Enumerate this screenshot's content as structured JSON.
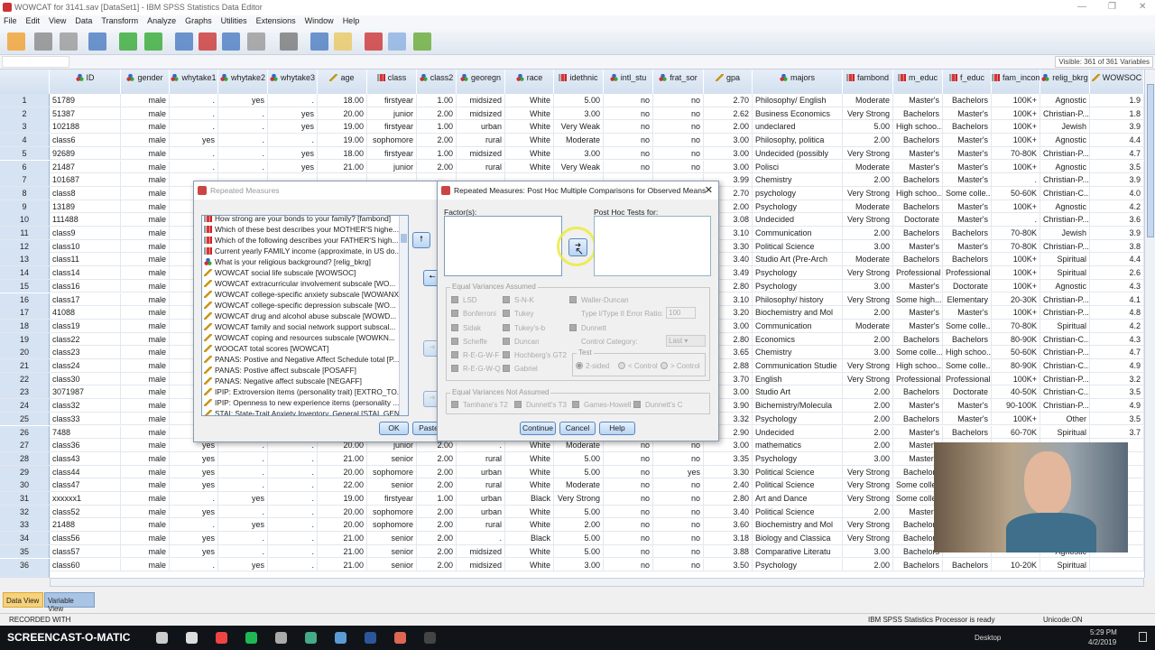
{
  "window": {
    "title": "WOWCAT for 3141.sav [DataSet1] - IBM SPSS Statistics Data Editor"
  },
  "menu": [
    "File",
    "Edit",
    "View",
    "Data",
    "Transform",
    "Analyze",
    "Graphs",
    "Utilities",
    "Extensions",
    "Window",
    "Help"
  ],
  "visible_vars": "Visible: 361 of 361 Variables",
  "columns": [
    {
      "name": "ID",
      "type": "nom"
    },
    {
      "name": "gender",
      "type": "nom"
    },
    {
      "name": "whytake1",
      "type": "nom"
    },
    {
      "name": "whytake2",
      "type": "nom"
    },
    {
      "name": "whytake3",
      "type": "nom"
    },
    {
      "name": "age",
      "type": "sca"
    },
    {
      "name": "class",
      "type": "ord"
    },
    {
      "name": "class2",
      "type": "nom"
    },
    {
      "name": "georegn",
      "type": "nom"
    },
    {
      "name": "race",
      "type": "nom"
    },
    {
      "name": "idethnic",
      "type": "ord"
    },
    {
      "name": "intl_stu",
      "type": "nom"
    },
    {
      "name": "frat_sor",
      "type": "nom"
    },
    {
      "name": "gpa",
      "type": "sca"
    },
    {
      "name": "majors",
      "type": "nom"
    },
    {
      "name": "fambond",
      "type": "ord"
    },
    {
      "name": "m_educ",
      "type": "ord"
    },
    {
      "name": "f_educ",
      "type": "ord"
    },
    {
      "name": "fam_income",
      "type": "ord"
    },
    {
      "name": "relig_bkrg",
      "type": "nom"
    },
    {
      "name": "WOWSOC",
      "type": "sca"
    }
  ],
  "rows": [
    [
      "51789",
      "male",
      ".",
      "yes",
      ".",
      "18.00",
      "firstyear",
      "1.00",
      "midsized",
      "White",
      "5.00",
      "no",
      "no",
      "2.70",
      "Philosophy/ English",
      "Moderate",
      "Master's",
      "Bachelors",
      "100K+",
      "Agnostic",
      "1.9"
    ],
    [
      "51387",
      "male",
      ".",
      ".",
      "yes",
      "20.00",
      "junior",
      "2.00",
      "midsized",
      "White",
      "3.00",
      "no",
      "no",
      "2.62",
      "Business Economics",
      "Very Strong",
      "Bachelors",
      "Master's",
      "100K+",
      "Christian-P...",
      "1.8"
    ],
    [
      "102188",
      "male",
      ".",
      ".",
      "yes",
      "19.00",
      "firstyear",
      "1.00",
      "urban",
      "White",
      "Very Weak",
      "no",
      "no",
      "2.00",
      "undeclared",
      "5.00",
      "High schoo...",
      "Bachelors",
      "100K+",
      "Jewish",
      "3.9"
    ],
    [
      "class6",
      "male",
      "yes",
      ".",
      ".",
      "19.00",
      "sophomore",
      "2.00",
      "rural",
      "White",
      "Moderate",
      "no",
      "no",
      "3.00",
      "Philosophy, politica",
      "2.00",
      "Bachelors",
      "Master's",
      "100K+",
      "Agnostic",
      "4.4"
    ],
    [
      "92689",
      "male",
      ".",
      ".",
      "yes",
      "18.00",
      "firstyear",
      "1.00",
      "midsized",
      "White",
      "3.00",
      "no",
      "no",
      "3.00",
      "Undecided (possibly",
      "Very Strong",
      "Master's",
      "Master's",
      "70-80K",
      "Christian-P...",
      "4.7"
    ],
    [
      "21487",
      "male",
      ".",
      ".",
      "yes",
      "21.00",
      "junior",
      "2.00",
      "rural",
      "White",
      "Very Weak",
      "no",
      "no",
      "3.00",
      "Polisci",
      "Moderate",
      "Master's",
      "Master's",
      "100K+",
      "Agnostic",
      "3.5"
    ],
    [
      "101687",
      "male",
      null,
      null,
      null,
      null,
      null,
      null,
      null,
      null,
      null,
      null,
      null,
      "3.99",
      "Chemistry",
      "2.00",
      "Bachelors",
      "Master's",
      ".",
      "Christian-P...",
      "3.9"
    ],
    [
      "class8",
      "male",
      null,
      null,
      null,
      null,
      null,
      null,
      null,
      null,
      null,
      null,
      null,
      "2.70",
      "psychology",
      "Very Strong",
      "High schoo...",
      "Some colle...",
      "50-60K",
      "Christian-C...",
      "4.0"
    ],
    [
      "13189",
      "male",
      null,
      null,
      null,
      null,
      null,
      null,
      null,
      null,
      null,
      null,
      null,
      "2.00",
      "Psychology",
      "Moderate",
      "Bachelors",
      "Master's",
      "100K+",
      "Agnostic",
      "4.2"
    ],
    [
      "111488",
      "male",
      null,
      null,
      null,
      null,
      null,
      null,
      null,
      null,
      null,
      null,
      null,
      "3.08",
      "Undecided",
      "Very Strong",
      "Doctorate",
      "Master's",
      ".",
      "Christian-P...",
      "3.6"
    ],
    [
      "class9",
      "male",
      null,
      null,
      null,
      null,
      null,
      null,
      null,
      null,
      null,
      null,
      null,
      "3.10",
      "Communication",
      "2.00",
      "Bachelors",
      "Bachelors",
      "70-80K",
      "Jewish",
      "3.9"
    ],
    [
      "class10",
      "male",
      null,
      null,
      null,
      null,
      null,
      null,
      null,
      null,
      null,
      null,
      null,
      "3.30",
      "Political Science",
      "3.00",
      "Master's",
      "Master's",
      "70-80K",
      "Christian-P...",
      "3.8"
    ],
    [
      "class11",
      "male",
      null,
      null,
      null,
      null,
      null,
      null,
      null,
      null,
      null,
      null,
      null,
      "3.40",
      "Studio Art (Pre-Arch",
      "Moderate",
      "Bachelors",
      "Bachelors",
      "100K+",
      "Spiritual",
      "4.4"
    ],
    [
      "class14",
      "male",
      null,
      null,
      null,
      null,
      null,
      null,
      null,
      null,
      null,
      null,
      null,
      "3.49",
      "Psychology",
      "Very Strong",
      "Professional",
      "Professional",
      "100K+",
      "Spiritual",
      "2.6"
    ],
    [
      "class16",
      "male",
      null,
      null,
      null,
      null,
      null,
      null,
      null,
      null,
      null,
      null,
      null,
      "2.80",
      "Psychology",
      "3.00",
      "Master's",
      "Doctorate",
      "100K+",
      "Agnostic",
      "4.3"
    ],
    [
      "class17",
      "male",
      null,
      null,
      null,
      null,
      null,
      null,
      null,
      null,
      null,
      null,
      null,
      "3.10",
      "Philosophy/ history",
      "Very Strong",
      "Some high...",
      "Elementary",
      "20-30K",
      "Christian-P...",
      "4.1"
    ],
    [
      "41088",
      "male",
      null,
      null,
      null,
      null,
      null,
      null,
      null,
      null,
      null,
      null,
      null,
      "3.20",
      "Biochemistry and Mol",
      "2.00",
      "Master's",
      "Master's",
      "100K+",
      "Christian-P...",
      "4.8"
    ],
    [
      "class19",
      "male",
      null,
      null,
      null,
      null,
      null,
      null,
      null,
      null,
      null,
      null,
      null,
      "3.00",
      "Communication",
      "Moderate",
      "Master's",
      "Some colle...",
      "70-80K",
      "Spiritual",
      "4.2"
    ],
    [
      "class22",
      "male",
      null,
      null,
      null,
      null,
      null,
      null,
      null,
      null,
      null,
      null,
      null,
      "2.80",
      "Economics",
      "2.00",
      "Bachelors",
      "Bachelors",
      "80-90K",
      "Christian-C...",
      "4.3"
    ],
    [
      "class23",
      "male",
      null,
      null,
      null,
      null,
      null,
      null,
      null,
      null,
      null,
      null,
      null,
      "3.65",
      "Chemistry",
      "3.00",
      "Some colle...",
      "High schoo...",
      "50-60K",
      "Christian-P...",
      "4.7"
    ],
    [
      "class24",
      "male",
      null,
      null,
      null,
      null,
      null,
      null,
      null,
      null,
      null,
      null,
      null,
      "2.88",
      "Communication Studie",
      "Very Strong",
      "High schoo...",
      "Some colle...",
      "80-90K",
      "Christian-C...",
      "4.9"
    ],
    [
      "class30",
      "male",
      null,
      null,
      null,
      null,
      null,
      null,
      null,
      null,
      null,
      null,
      null,
      "3.70",
      "English",
      "Very Strong",
      "Professional",
      "Professional",
      "100K+",
      "Christian-P...",
      "3.2"
    ],
    [
      "3071987",
      "male",
      null,
      null,
      null,
      null,
      null,
      null,
      null,
      null,
      null,
      null,
      null,
      "3.00",
      "Studio Art",
      "2.00",
      "Bachelors",
      "Doctorate",
      "40-50K",
      "Christian-C...",
      "3.5"
    ],
    [
      "class32",
      "male",
      null,
      null,
      null,
      null,
      null,
      null,
      null,
      null,
      null,
      null,
      null,
      "3.90",
      "Bichemistry/Molecula",
      "2.00",
      "Master's",
      "Master's",
      "90-100K",
      "Christian-P...",
      "4.9"
    ],
    [
      "class33",
      "male",
      null,
      null,
      null,
      null,
      null,
      null,
      null,
      null,
      null,
      null,
      null,
      "3.32",
      "Psychology",
      "2.00",
      "Bachelors",
      "Master's",
      "100K+",
      "Other",
      "3.5"
    ],
    [
      "7488",
      "male",
      null,
      null,
      null,
      null,
      null,
      null,
      null,
      null,
      null,
      null,
      null,
      "2.90",
      "Undecided",
      "2.00",
      "Master's",
      "Bachelors",
      "60-70K",
      "Spiritual",
      "3.7"
    ],
    [
      "class36",
      "male",
      "yes",
      ".",
      ".",
      "20.00",
      "junior",
      "2.00",
      ".",
      "White",
      "Moderate",
      "no",
      "no",
      "3.00",
      "mathematics",
      "2.00",
      "Master's",
      null,
      null,
      null,
      null
    ],
    [
      "class43",
      "male",
      "yes",
      ".",
      ".",
      "21.00",
      "senior",
      "2.00",
      "rural",
      "White",
      "5.00",
      "no",
      "no",
      "3.35",
      "Psychology",
      "3.00",
      "Master's",
      null,
      null,
      null,
      null
    ],
    [
      "class44",
      "male",
      "yes",
      ".",
      ".",
      "20.00",
      "sophomore",
      "2.00",
      "urban",
      "White",
      "5.00",
      "no",
      "yes",
      "3.30",
      "Political Science",
      "Very Strong",
      "Bachelors",
      null,
      null,
      null,
      null
    ],
    [
      "class47",
      "male",
      "yes",
      ".",
      ".",
      "22.00",
      "senior",
      "2.00",
      "rural",
      "White",
      "Moderate",
      "no",
      "no",
      "2.40",
      "Political Science",
      "Very Strong",
      "Some colle...",
      null,
      null,
      null,
      null
    ],
    [
      "xxxxxx1",
      "male",
      ".",
      "yes",
      ".",
      "19.00",
      "firstyear",
      "1.00",
      "urban",
      "Black",
      "Very Strong",
      "no",
      "no",
      "2.80",
      "Art and Dance",
      "Very Strong",
      "Some colle...",
      null,
      null,
      null,
      null
    ],
    [
      "class52",
      "male",
      "yes",
      ".",
      ".",
      "20.00",
      "sophomore",
      "2.00",
      "urban",
      "White",
      "5.00",
      "no",
      "no",
      "3.40",
      "Political Science",
      "2.00",
      "Master's",
      null,
      null,
      null,
      null
    ],
    [
      "21488",
      "male",
      ".",
      "yes",
      ".",
      "20.00",
      "sophomore",
      "2.00",
      "rural",
      "White",
      "2.00",
      "no",
      "no",
      "3.60",
      "Biochemistry and Mol",
      "Very Strong",
      "Bachelors",
      null,
      null,
      null,
      null
    ],
    [
      "class56",
      "male",
      "yes",
      ".",
      ".",
      "21.00",
      "senior",
      "2.00",
      ".",
      "Black",
      "5.00",
      "no",
      "no",
      "3.18",
      "Biology and Classica",
      "Very Strong",
      "Bachelors",
      null,
      null,
      null,
      null
    ],
    [
      "class57",
      "male",
      "yes",
      ".",
      ".",
      "21.00",
      "senior",
      "2.00",
      "midsized",
      "White",
      "5.00",
      "no",
      "no",
      "3.88",
      "Comparative Literatu",
      "3.00",
      "Bachelors",
      null,
      null,
      "Agnostic",
      null
    ],
    [
      "class60",
      "male",
      ".",
      "yes",
      ".",
      "21.00",
      "senior",
      "2.00",
      "midsized",
      "White",
      "3.00",
      "no",
      "no",
      "3.50",
      "Psychology",
      "2.00",
      "Bachelors",
      "Bachelors",
      "10-20K",
      "Spiritual",
      null
    ]
  ],
  "tabs": {
    "data_view": "Data View",
    "variable_view": "Variable View"
  },
  "status": {
    "recorded": "RECORDED WITH",
    "processor": "IBM SPSS Statistics Processor is ready",
    "unicode": "Unicode:ON"
  },
  "taskbar": {
    "desktop": "Desktop",
    "time": "5:29 PM",
    "date": "4/2/2019",
    "screencast": "SCREENCAST-O-MATIC"
  },
  "rm_dialog": {
    "title": "Repeated Measures",
    "ok": "OK",
    "paste": "Paste",
    "variables": [
      {
        "label": "How strong are your bonds to your family? [fambond]",
        "type": "ord"
      },
      {
        "label": "Which of these best describes your MOTHER'S highe...",
        "type": "ord"
      },
      {
        "label": "Which of the following describes your FATHER'S high...",
        "type": "ord"
      },
      {
        "label": "Current yearly FAMILY income (approximate, in US do...",
        "type": "ord"
      },
      {
        "label": "What is your religious background? [relig_bkrg]",
        "type": "nom"
      },
      {
        "label": "WOWCAT social life subscale [WOWSOC]",
        "type": "sca"
      },
      {
        "label": "WOWCAT extracurricular involvement subscale [WO...",
        "type": "sca"
      },
      {
        "label": "WOWCAT college-specific anxiety subscale [WOWANX]",
        "type": "sca"
      },
      {
        "label": "WOWCAT college-specific depression subscale [WO...",
        "type": "sca"
      },
      {
        "label": "WOWCAT drug and alcohol abuse subscale [WOWD...",
        "type": "sca"
      },
      {
        "label": "WOWCAT family and social network support subscal...",
        "type": "sca"
      },
      {
        "label": "WOWCAT coping and resources subscale [WOWKN...",
        "type": "sca"
      },
      {
        "label": "WOOCAT total scores [WOWCAT]",
        "type": "sca"
      },
      {
        "label": "PANAS: Postive and Negative Affect Schedule total [P...",
        "type": "sca"
      },
      {
        "label": "PANAS: Postive affect subscale [POSAFF]",
        "type": "sca"
      },
      {
        "label": "PANAS: Negative affect subscale [NEGAFF]",
        "type": "sca"
      },
      {
        "label": "IPIP: Extroversion items (personality trait) [EXTRO_TO...",
        "type": "sca"
      },
      {
        "label": "IPIP: Openness to new experience items (personality ...",
        "type": "sca"
      },
      {
        "label": "STAI: State-Trait Anxiety Inventory, General [STAI_GENI",
        "type": "sca"
      }
    ]
  },
  "posthoc": {
    "title": "Repeated Measures: Post Hoc Multiple Comparisons for Observed Means",
    "factors_label": "Factor(s):",
    "tests_for_label": "Post Hoc Tests for:",
    "eva_label": "Equal Variances Assumed",
    "eva": [
      "LSD",
      "Bonferroni",
      "Sidak",
      "Scheffe",
      "R-E-G-W-F",
      "R-E-G-W-Q",
      "S-N-K",
      "Tukey",
      "Tukey's-b",
      "Duncan",
      "Hochberg's GT2",
      "Gabriel",
      "Waller-Duncan",
      "Dunnett"
    ],
    "ratio_label": "Type I/Type II Error Ratio:",
    "ratio_value": "100",
    "control_label": "Control Category:",
    "control_value": "Last",
    "test_label": "Test",
    "test_options": [
      "2-sided",
      "< Control",
      "> Control"
    ],
    "evna_label": "Equal Variances Not Assumed",
    "evna": [
      "Tamhane's T2",
      "Dunnett's T3",
      "Games-Howell",
      "Dunnett's C"
    ],
    "continue": "Continue",
    "cancel": "Cancel",
    "help": "Help"
  }
}
